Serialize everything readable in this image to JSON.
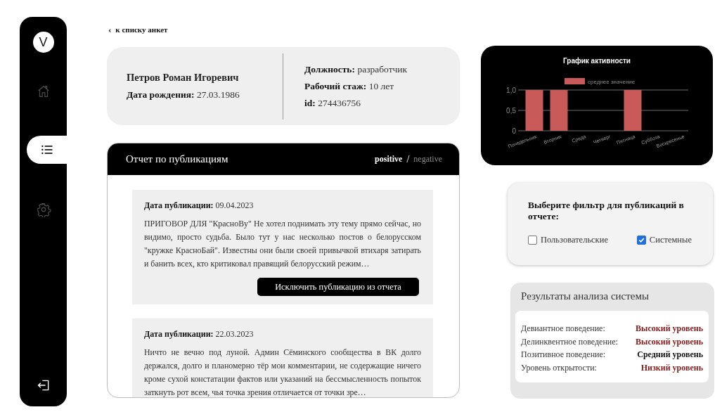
{
  "sidebar": {
    "avatar": "V",
    "items": [
      {
        "kind": "home",
        "selected": false
      },
      {
        "kind": "list",
        "selected": true
      },
      {
        "kind": "settings",
        "selected": false
      }
    ],
    "logout": {
      "kind": "logout"
    }
  },
  "back_link": {
    "icon": "‹",
    "label": "к списку анкет"
  },
  "profile": {
    "name": "Петров Роман Игоревич",
    "fields_left": [
      {
        "label": "Дата рождения:",
        "value": "27.03.1986"
      }
    ],
    "fields_right": [
      {
        "label": "Должность:",
        "value": "разработчик"
      },
      {
        "label": "Рабочий стаж:",
        "value": "10 лет"
      },
      {
        "label": "id:",
        "value": "274436756"
      }
    ]
  },
  "report": {
    "title": "Отчет по публикациям",
    "separator": "/",
    "tabs": [
      {
        "label": "positive",
        "selected": true
      },
      {
        "label": "negative",
        "selected": false
      }
    ],
    "posts": [
      {
        "date_label": "Дата публикации:",
        "date": "09.04.2023",
        "text": "ПРИГОВОР ДЛЯ \"КрасноBy\" Не хотел поднимать эту тему прямо сейчас, но видимо, просто судьба. Было тут у нас несколько постов о белорусском \"кружке КрасноБай\". Известны они были своей привычкой втихаря затирать и банить всех, кто критиковал правящий белорусский режим…",
        "button": "Исключить публикацию из отчета"
      },
      {
        "date_label": "Дата публикации:",
        "date": "22.03.2023",
        "text": "Ничто не вечно под луной. Админ Сёминского сообщества в ВК долго держался, долго и планомерно тёр мои комментарии, не содержащие ничего кроме сухой констатации фактов или указаний на бессмысленность попыток заткнуть рот всем, чья точка зрения отличается от точки зре…"
      }
    ]
  },
  "activity": {
    "chart_data": {
      "type": "bar",
      "title": "График активности",
      "categories": [
        "Понедельник",
        "Вторник",
        "Среда",
        "Четверг",
        "Пятница",
        "Суббота",
        "Воскресенье"
      ],
      "series": [
        {
          "name": "среднее значение",
          "color": "#c85a5a",
          "values": [
            1,
            1,
            0,
            0,
            1,
            0,
            0
          ]
        }
      ],
      "ylim": [
        0,
        1
      ],
      "yticks": [
        {
          "value": 0,
          "label": "0"
        },
        {
          "value": 0.5,
          "label": "0,5"
        },
        {
          "value": 1,
          "label": "1,0"
        }
      ]
    }
  },
  "filter": {
    "title": "Выберите фильтр для публикаций в отчете:",
    "options": [
      {
        "label": "Пользовательские",
        "checked": false
      },
      {
        "label": "Системные",
        "checked": true
      }
    ]
  },
  "results": {
    "title": "Результаты анализа системы",
    "rows": [
      {
        "label": "Девиантное поведение:",
        "value": "Высокий уровень",
        "color": "#8b1a1a"
      },
      {
        "label": "Делинквентное поведение:",
        "value": "Высокий уровень",
        "color": "#8b1a1a"
      },
      {
        "label": "Позитивное поведение:",
        "value": "Средний уровень",
        "color": "#111111"
      },
      {
        "label": "Уровень открытости:",
        "value": "Низкий уровень",
        "color": "#8b1a1a"
      }
    ]
  }
}
